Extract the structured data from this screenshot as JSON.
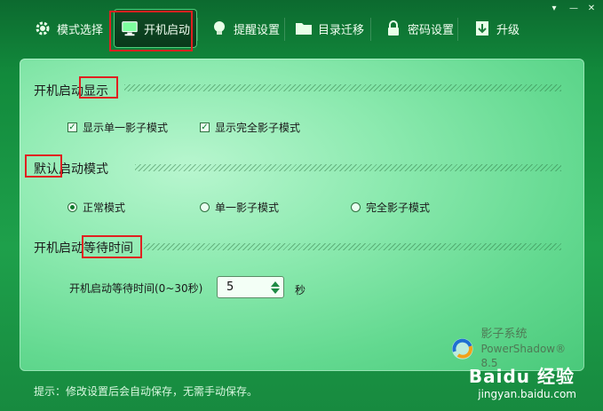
{
  "window": {
    "controls": [
      "▾",
      "—",
      "✕"
    ]
  },
  "tabs": [
    {
      "label": "模式选择",
      "icon": "gear-icon",
      "active": false
    },
    {
      "label": "开机启动",
      "icon": "monitor-icon",
      "active": true
    },
    {
      "label": "提醒设置",
      "icon": "lightbulb-icon",
      "active": false
    },
    {
      "label": "目录迁移",
      "icon": "folder-icon",
      "active": false
    },
    {
      "label": "密码设置",
      "icon": "lock-icon",
      "active": false
    },
    {
      "label": "升级",
      "icon": "download-icon",
      "active": false
    }
  ],
  "sections": {
    "display": {
      "title": "开机启动显示",
      "options": [
        {
          "label": "显示单一影子模式",
          "checked": true
        },
        {
          "label": "显示完全影子模式",
          "checked": true
        }
      ]
    },
    "default_mode": {
      "title": "默认启动模式",
      "options": [
        {
          "label": "正常模式",
          "selected": true
        },
        {
          "label": "单一影子模式",
          "selected": false
        },
        {
          "label": "完全影子模式",
          "selected": false
        }
      ]
    },
    "wait": {
      "title": "开机启动等待时间",
      "field_label": "开机启动等待时间(0~30秒)",
      "value": "5",
      "unit": "秒"
    }
  },
  "logo": {
    "name": "影子系统",
    "product": "PowerShadow",
    "version": "8.5"
  },
  "footer": {
    "tip": "提示：修改设置后会自动保存，无需手动保存。"
  },
  "watermark": {
    "brand": "Baidu 经验",
    "url": "jingyan.baidu.com"
  },
  "colors": {
    "accent": "#1ea04b",
    "highlight": "#e02020"
  }
}
